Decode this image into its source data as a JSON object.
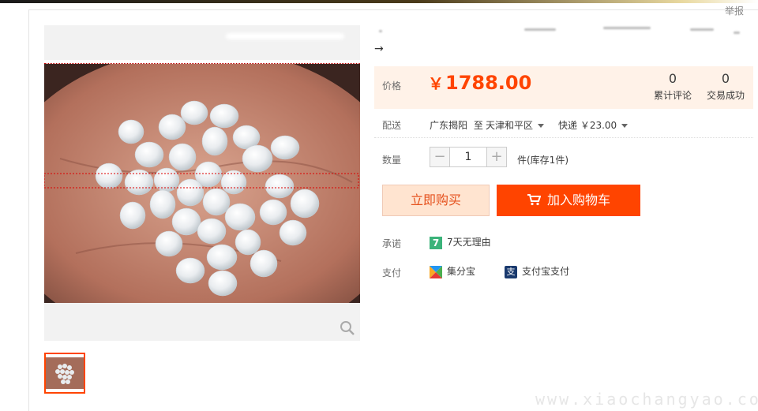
{
  "header": {
    "report_label": "举报"
  },
  "product": {
    "arrow": "→",
    "price_label": "价格",
    "price_currency": "￥",
    "price_value": "1788.00",
    "reviews_count": "0",
    "reviews_label": "累计评论",
    "deals_count": "0",
    "deals_label": "交易成功"
  },
  "delivery": {
    "label": "配送",
    "from": "广东揭阳",
    "to_word": "至",
    "to": "天津和平区",
    "shipping": "快递 ￥23.00"
  },
  "quantity": {
    "label": "数量",
    "minus": "−",
    "value": "1",
    "plus": "+",
    "stock": "件(库存1件)"
  },
  "actions": {
    "buy_now": "立即购买",
    "add_to_cart": "加入购物车"
  },
  "promise": {
    "label": "承诺",
    "icon_text": "7",
    "text": "7天无理由"
  },
  "payment": {
    "label": "支付",
    "method1": "集分宝",
    "method2_icon": "支",
    "method2": "支付宝支付"
  },
  "watermark": "www.xiaochangyao.com",
  "colors": {
    "accent": "#ff4400",
    "price_bg": "#fff2e8",
    "buy_bg": "#ffe4d0"
  },
  "icons": [
    "search-icon",
    "cart-icon",
    "seven-day-icon",
    "jifenbao-icon",
    "alipay-icon"
  ]
}
